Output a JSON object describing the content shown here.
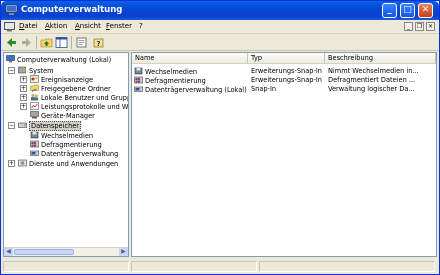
{
  "window": {
    "title": "Computerverwaltung"
  },
  "menubar": {
    "items": [
      "Datei",
      "Aktion",
      "Ansicht",
      "Fenster",
      "?"
    ]
  },
  "toolbar": {
    "icons": [
      "back-arrow-icon",
      "forward-arrow-icon",
      "up-folder-icon",
      "show-hide-tree-icon",
      "properties-icon",
      "help-icon"
    ]
  },
  "tree": {
    "root": "Computerverwaltung (Lokal)",
    "system": "System",
    "system_children": [
      "Ereignisanzeige",
      "Freigegebene Ordner",
      "Lokale Benutzer und Gruppen",
      "Leistungsprotokolle und Warnungen",
      "Geräte-Manager"
    ],
    "storage": "Datenspeicher",
    "storage_children": [
      "Wechselmedien",
      "Defragmentierung",
      "Datenträgerverwaltung"
    ],
    "services": "Dienste und Anwendungen"
  },
  "list": {
    "columns": [
      "Name",
      "Typ",
      "Beschreibung"
    ],
    "rows": [
      {
        "name": "Wechselmedien",
        "type": "Erweiterungs-Snap-In",
        "desc": "Nimmt Wechselmedien in..."
      },
      {
        "name": "Defragmentierung",
        "type": "Erweiterungs-Snap-In",
        "desc": "Defragmentiert Dateien ..."
      },
      {
        "name": "Datenträgerverwaltung (Lokal)",
        "type": "Snap-In",
        "desc": "Verwaltung logischer Da..."
      }
    ]
  },
  "colors": {
    "titlebar": "#0a5fe8",
    "selection": "#d4d0c8",
    "pane_border": "#7f9db9"
  }
}
